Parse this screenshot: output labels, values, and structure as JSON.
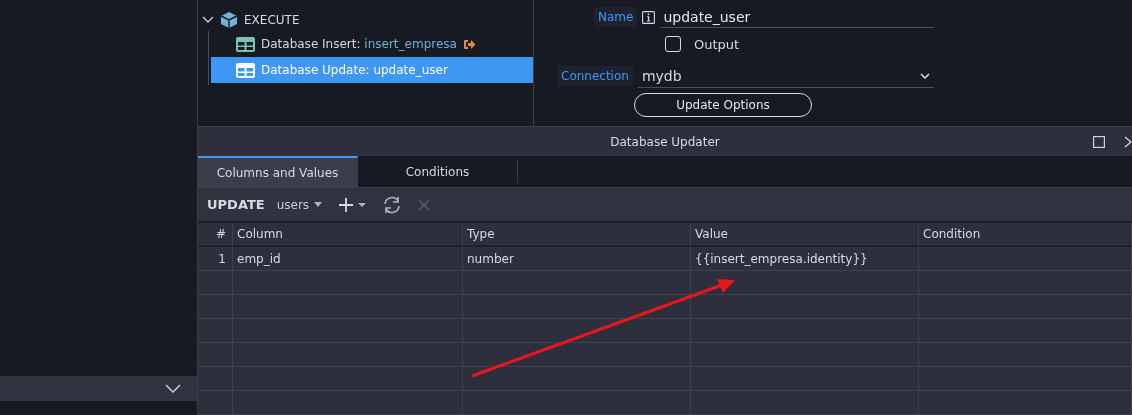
{
  "tree": {
    "group": {
      "label": "EXECUTE",
      "expanded": true
    },
    "items": [
      {
        "kind": "insert",
        "label": "Database Insert:",
        "name": "insert_empresa",
        "selected": false,
        "output": true
      },
      {
        "kind": "update",
        "label": "Database Update:",
        "name": "update_user",
        "selected": true,
        "output": false
      }
    ]
  },
  "properties": {
    "name_label": "Name",
    "name_value": "update_user",
    "output_label": "Output",
    "output_checked": false,
    "connection_label": "Connection",
    "connection_value": "mydb",
    "options_button": "Update Options"
  },
  "panel": {
    "title": "Database Updater",
    "tabs": [
      {
        "label": "Columns and Values",
        "selected": true
      },
      {
        "label": "Conditions",
        "selected": false
      }
    ],
    "toolbar": {
      "keyword": "UPDATE",
      "table": "users"
    },
    "table": {
      "columns": [
        "#",
        "Column",
        "Type",
        "Value",
        "Condition"
      ],
      "rows": [
        [
          "1",
          "emp_id",
          "number",
          "{{insert_empresa.identity}}",
          ""
        ]
      ]
    }
  },
  "annotations": [
    {
      "kind": "arrow"
    }
  ]
}
